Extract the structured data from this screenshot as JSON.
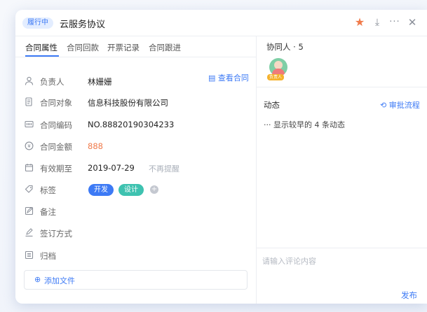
{
  "header": {
    "status": "履行中",
    "title": "云服务协议",
    "icons": {
      "star": "star-icon",
      "download": "download-icon",
      "more": "more-icon",
      "close": "close-icon"
    },
    "accent_color": "#3d7af5"
  },
  "tabs": [
    {
      "label": "合同属性",
      "active": true
    },
    {
      "label": "合同回款",
      "active": false
    },
    {
      "label": "开票记录",
      "active": false
    },
    {
      "label": "合同跟进",
      "active": false
    }
  ],
  "view_contract": "查看合同",
  "fields": {
    "owner": {
      "label": "负责人",
      "value": "林姗姗"
    },
    "target": {
      "label": "合同对象",
      "value": "信息科技股份有限公司"
    },
    "code": {
      "label": "合同编码",
      "value": "NO.88820190304233"
    },
    "amount": {
      "label": "合同金额",
      "value": "888"
    },
    "valid_until": {
      "label": "有效期至",
      "value": "2019-07-29",
      "remind": "不再提醒"
    },
    "tags": {
      "label": "标签",
      "items": [
        "开发",
        "设计"
      ]
    },
    "note": {
      "label": "备注"
    },
    "sign_method": {
      "label": "签订方式"
    },
    "archive": {
      "label": "归档"
    }
  },
  "add_file": "添加文件",
  "collaborators": {
    "title": "协同人 · 5",
    "owner_badge": "负责人"
  },
  "activity": {
    "title": "动态",
    "approval_link": "审批流程",
    "earlier": "··· 显示较早的 4 条动态"
  },
  "comment": {
    "placeholder": "请输入评论内容",
    "submit": "发布"
  }
}
